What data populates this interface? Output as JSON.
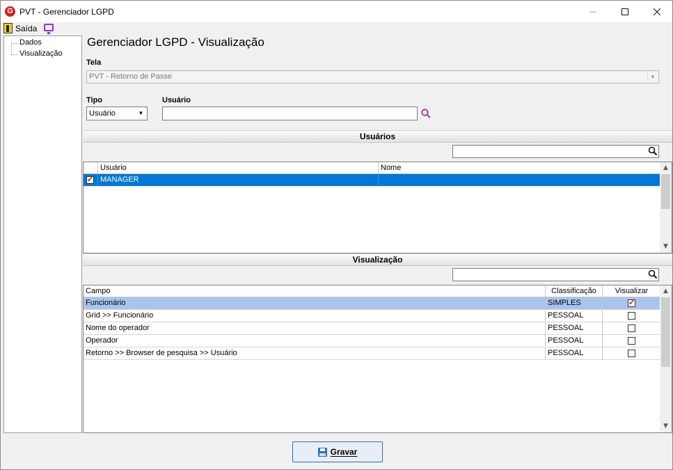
{
  "window": {
    "title": "PVT - Gerenciador LGPD",
    "app_icon_letter": "G",
    "controls": [
      "minimize",
      "maximize",
      "close"
    ]
  },
  "menubar": {
    "exit_label": "Saída"
  },
  "tree": {
    "items": [
      {
        "label": "Dados"
      },
      {
        "label": "Visualização"
      }
    ]
  },
  "page": {
    "title": "Gerenciador LGPD - Visualização"
  },
  "form": {
    "tela_label": "Tela",
    "tela_value": "PVT - Retorno de Passe",
    "tipo_label": "Tipo",
    "tipo_value": "Usuário",
    "usuario_label": "Usuário",
    "usuario_value": ""
  },
  "usuarios": {
    "section_title": "Usuários",
    "search_value": "",
    "columns": [
      "Usuário",
      "Nome"
    ],
    "rows": [
      {
        "checked": true,
        "usuario": "MANAGER",
        "nome": "",
        "selected": true
      }
    ]
  },
  "visualizacao": {
    "section_title": "Visualização",
    "search_value": "",
    "columns": [
      "Campo",
      "Classificação",
      "Visualizar"
    ],
    "rows": [
      {
        "campo": "Funcionário",
        "classificacao": "SIMPLES",
        "visualizar": true,
        "selected": true
      },
      {
        "campo": "Grid >> Funcionário",
        "classificacao": "PESSOAL",
        "visualizar": false,
        "selected": false
      },
      {
        "campo": "Nome do operador",
        "classificacao": "PESSOAL",
        "visualizar": false,
        "selected": false
      },
      {
        "campo": "Operador",
        "classificacao": "PESSOAL",
        "visualizar": false,
        "selected": false
      },
      {
        "campo": "Retorno >> Browser de pesquisa >> Usuário",
        "classificacao": "PESSOAL",
        "visualizar": false,
        "selected": false
      }
    ]
  },
  "footer": {
    "save_label": "Gravar"
  },
  "colors": {
    "selection_blue": "#0078d7",
    "selection_light": "#a9c4ec",
    "accent_purple": "#9b2fc7",
    "check_red": "#d01010"
  }
}
